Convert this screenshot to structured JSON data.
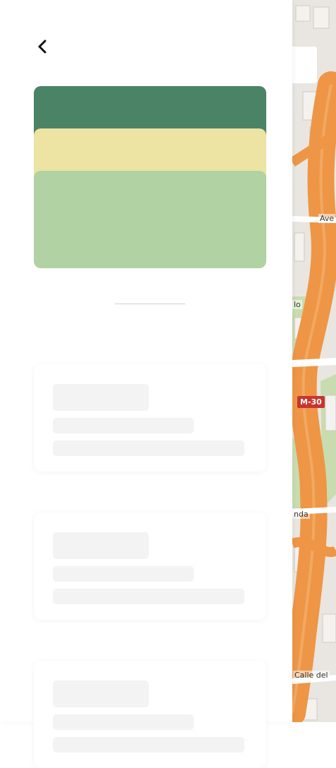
{
  "map": {
    "labels": {
      "ave": "Ave",
      "lo": "lo",
      "nda": "nda",
      "calle_del": "Calle del",
      "shield": "M-30"
    },
    "colors": {
      "road": "#ee9645",
      "background": "#e9e6e1",
      "park": "#c8dcb0"
    }
  },
  "header": {
    "back_icon": "chevron-left-icon"
  },
  "card_stack": {
    "colors": [
      "#4a8366",
      "#ede3a3",
      "#b1d2a3"
    ]
  },
  "skeleton_cards_count": 3
}
